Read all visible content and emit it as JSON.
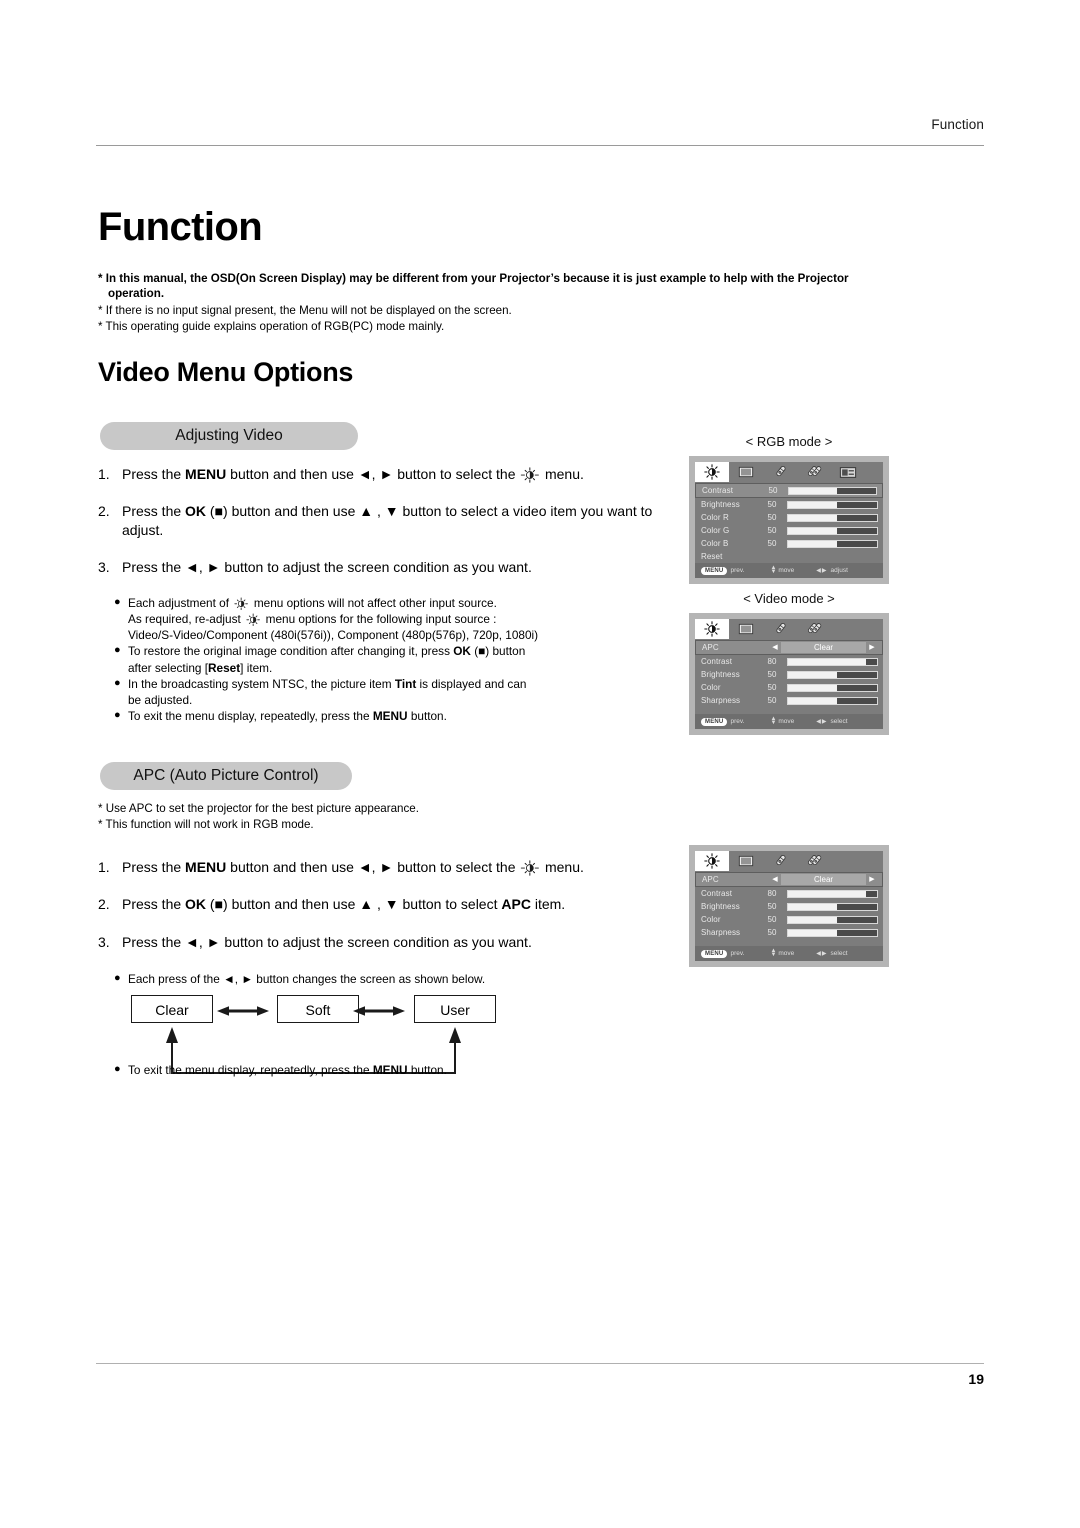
{
  "page": {
    "running_head": "Function",
    "title": "Function",
    "number": "19"
  },
  "intro_notes": [
    {
      "text": "* In this manual, the OSD(On Screen Display) may be different from your Projector’s because it is just example to help with the Projector",
      "continuation": "operation.",
      "bold": true
    },
    {
      "text": "* If there is no input signal present, the Menu will not be displayed on the screen.",
      "bold": false
    },
    {
      "text": "* This operating guide explains operation of RGB(PC) mode mainly.",
      "bold": false
    }
  ],
  "section": {
    "title": "Video Menu Options"
  },
  "adjusting_video": {
    "pill_label": "Adjusting Video",
    "steps": [
      {
        "num": "1.",
        "pre": "Press the ",
        "b1": "MENU",
        "mid": " button and then use ◄, ► button to select the ",
        "post": " menu."
      },
      {
        "num": "2.",
        "pre": "Press the ",
        "b1": "OK",
        "mid": " (■) button and then use ▲ , ▼ button to select a video item you want to adjust.",
        "post": ""
      },
      {
        "num": "3.",
        "pre": "Press the ◄, ► button to adjust the screen condition as you want.",
        "b1": "",
        "mid": "",
        "post": ""
      }
    ],
    "bullets": [
      {
        "lead": "Each adjustment of ",
        "after_icon": " menu options will not affect other input source.",
        "line2_pre": "As required, re-adjust ",
        "line2_post": " menu options for the following input source :",
        "line3": "Video/S-Video/Component (480i(576i)), Component (480p(576p), 720p, 1080i)"
      },
      {
        "line1_a": "To restore the original image condition after changing it, press ",
        "line1_b": "OK",
        "line1_c": " (■) button",
        "line2_a": "after selecting [",
        "line2_b": "Reset",
        "line2_c": "] item."
      },
      {
        "line1_a": "In the broadcasting system NTSC, the picture item ",
        "line1_b": "Tint",
        "line1_c": " is displayed and can",
        "line2_a": "be adjusted."
      },
      {
        "line1_a": "To exit the menu display, repeatedly, press the ",
        "line1_b": "MENU",
        "line1_c": " button."
      }
    ]
  },
  "apc_section": {
    "pill_label": "APC (Auto Picture Control)",
    "notes": [
      "* Use APC to set the projector for the best picture appearance.",
      "* This function will not work in RGB mode."
    ],
    "steps": [
      {
        "num": "1.",
        "pre": "Press the ",
        "b1": "MENU",
        "mid": " button and then use ◄, ► button to select the ",
        "post": " menu."
      },
      {
        "num": "2.",
        "pre": "Press the ",
        "b1": "OK",
        "mid": " (■) button and then use ▲ , ▼ button to select ",
        "b2": "APC",
        "post": " item."
      },
      {
        "num": "3.",
        "pre": "Press the ◄, ► button to adjust the screen condition as you want.",
        "b1": "",
        "mid": "",
        "post": ""
      }
    ],
    "bullet_top": {
      "line1_a": "Each press of the ◄, ► button changes the screen as shown below."
    },
    "bullet_bottom": {
      "line1_a": "To exit the menu display, repeatedly, press the ",
      "line1_b": "MENU",
      "line1_c": " button."
    },
    "flow": {
      "boxes": [
        "Clear",
        "Soft",
        "User"
      ]
    }
  },
  "osd_panels": [
    {
      "id": "rgb",
      "caption": "< RGB mode >",
      "tabs": [
        "contrast-brightness-icon",
        "screen-icon",
        "tag-icon",
        "double-tag-icon",
        "display-icon"
      ],
      "active_tab": 0,
      "rows": [
        {
          "label": "Contrast",
          "value": "50",
          "fill_pct": 55,
          "selected": true
        },
        {
          "label": "Brightness",
          "value": "50",
          "fill_pct": 55,
          "selected": false
        },
        {
          "label": "Color R",
          "value": "50",
          "fill_pct": 55,
          "selected": false
        },
        {
          "label": "Color G",
          "value": "50",
          "fill_pct": 55,
          "selected": false
        },
        {
          "label": "Color B",
          "value": "50",
          "fill_pct": 55,
          "selected": false
        },
        {
          "label": "Reset",
          "value": "",
          "fill_pct": null,
          "selected": false
        }
      ],
      "footer": {
        "menu_key": "MENU",
        "prev": "prev.",
        "move": "move",
        "action": "adjust"
      }
    },
    {
      "id": "video",
      "caption": "< Video mode >",
      "tabs": [
        "contrast-brightness-icon",
        "screen-icon",
        "tag-icon",
        "double-tag-icon"
      ],
      "active_tab": 0,
      "apc_row": {
        "label": "APC",
        "value": "Clear"
      },
      "rows": [
        {
          "label": "Contrast",
          "value": "80",
          "fill_pct": 88,
          "selected": false
        },
        {
          "label": "Brightness",
          "value": "50",
          "fill_pct": 55,
          "selected": false
        },
        {
          "label": "Color",
          "value": "50",
          "fill_pct": 55,
          "selected": false
        },
        {
          "label": "Sharpness",
          "value": "50",
          "fill_pct": 55,
          "selected": false
        }
      ],
      "footer": {
        "menu_key": "MENU",
        "prev": "prev.",
        "move": "move",
        "action": "select"
      }
    },
    {
      "id": "apc",
      "caption": "",
      "tabs": [
        "contrast-brightness-icon",
        "screen-icon",
        "tag-icon",
        "double-tag-icon"
      ],
      "active_tab": 0,
      "apc_row": {
        "label": "APC",
        "value": "Clear"
      },
      "rows": [
        {
          "label": "Contrast",
          "value": "80",
          "fill_pct": 88,
          "selected": false
        },
        {
          "label": "Brightness",
          "value": "50",
          "fill_pct": 55,
          "selected": false
        },
        {
          "label": "Color",
          "value": "50",
          "fill_pct": 55,
          "selected": false
        },
        {
          "label": "Sharpness",
          "value": "50",
          "fill_pct": 55,
          "selected": false
        }
      ],
      "footer": {
        "menu_key": "MENU",
        "prev": "prev.",
        "move": "move",
        "action": "select"
      }
    }
  ]
}
